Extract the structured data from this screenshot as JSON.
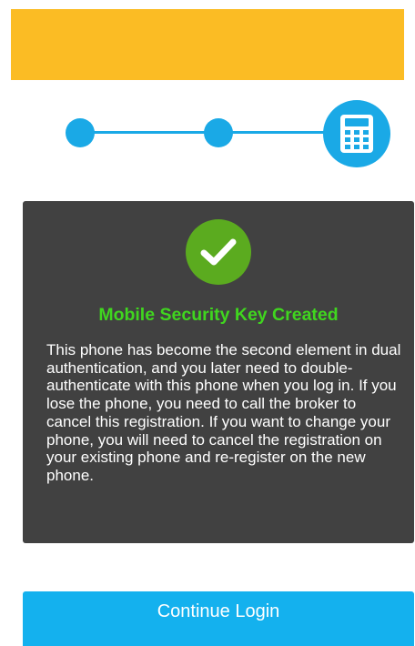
{
  "colors": {
    "header": "#fbbc24",
    "accent": "#1aa9e6",
    "card_background": "#414141",
    "success_green": "#5bab1f",
    "title_green": "#40d61f",
    "button": "#14b1ee"
  },
  "stepper": {
    "total_steps": 3,
    "current_step": 3,
    "current_step_icon": "calculator-icon"
  },
  "card": {
    "icon": "checkmark-icon",
    "title": "Mobile Security Key Created",
    "body": "This phone has become the second element in dual authentication, and you later need to double-authenticate with this phone when you log in. If you lose the phone, you need to call the broker to cancel this registration. If you want to change your phone, you will need to cancel the registration on your existing phone and re-register on the new phone."
  },
  "actions": {
    "continue_label": "Continue Login"
  }
}
